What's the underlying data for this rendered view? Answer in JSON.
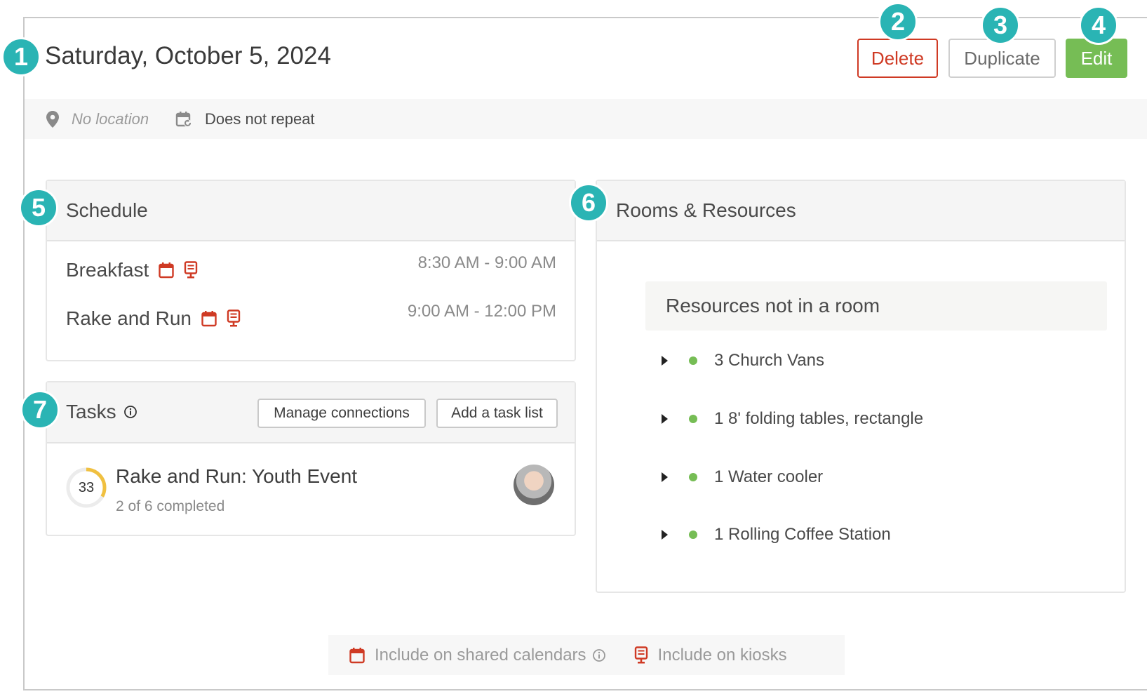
{
  "header": {
    "title": "Saturday, October 5, 2024",
    "delete_label": "Delete",
    "duplicate_label": "Duplicate",
    "edit_label": "Edit"
  },
  "meta": {
    "location": "No location",
    "repeat": "Does not repeat"
  },
  "schedule": {
    "title": "Schedule",
    "items": [
      {
        "name": "Breakfast",
        "time": "8:30 AM - 9:00 AM"
      },
      {
        "name": "Rake and Run",
        "time": "9:00 AM - 12:00 PM"
      }
    ]
  },
  "tasks": {
    "title": "Tasks",
    "manage_label": "Manage connections",
    "add_label": "Add a task list",
    "items": [
      {
        "progress_text": "33",
        "progress_fraction": 0.33,
        "title": "Rake and Run: Youth Event",
        "subtitle": "2 of 6 completed"
      }
    ]
  },
  "rooms": {
    "title": "Rooms & Resources",
    "group_title": "Resources not in a room",
    "items": [
      {
        "label": "3 Church Vans"
      },
      {
        "label": "1 8' folding tables, rectangle"
      },
      {
        "label": "1 Water cooler"
      },
      {
        "label": "1 Rolling Coffee Station"
      }
    ]
  },
  "legend": {
    "calendars": "Include on shared calendars",
    "kiosks": "Include on kiosks"
  },
  "badges": [
    "1",
    "2",
    "3",
    "4",
    "5",
    "6",
    "7"
  ],
  "colors": {
    "accent_red": "#cf3a24",
    "edit_green": "#76bd55",
    "badge_teal": "#2ab4b4",
    "progress_yellow": "#f0c040"
  },
  "icons": {
    "location": "map-pin-icon",
    "repeat": "calendar-repeat-icon",
    "calendar": "calendar-icon",
    "kiosk": "kiosk-icon",
    "info": "info-icon",
    "expand": "caret-right-icon"
  }
}
